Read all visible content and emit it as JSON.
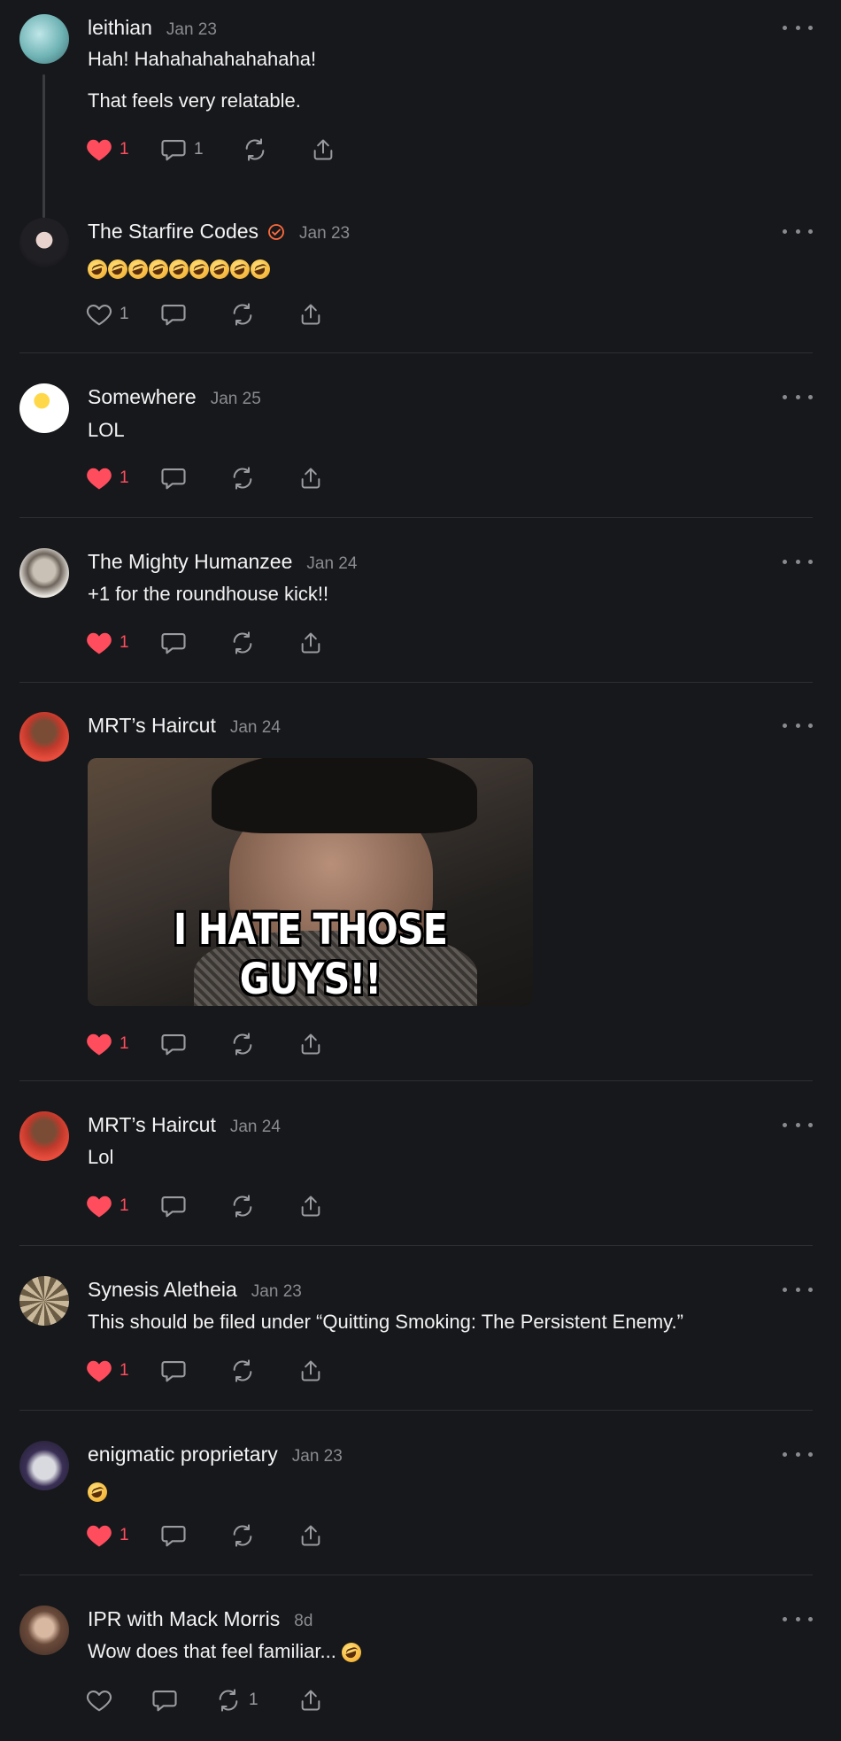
{
  "posts": [
    {
      "author": "leithian",
      "date": "Jan 23",
      "lines": [
        "Hah! Hahahahahahahaha!",
        "That feels very relatable."
      ],
      "likes": "1",
      "liked": true,
      "replies": "1",
      "reposts": "",
      "avatar_icon": "avatar-leithian"
    },
    {
      "author": "The Starfire Codes",
      "verified": true,
      "date": "Jan 23",
      "emoji_text": "🤣🤣🤣🤣🤣🤣🤣🤣🤣",
      "likes": "1",
      "liked": false,
      "replies": "",
      "reposts": "",
      "avatar_icon": "avatar-starfire"
    },
    {
      "author": "Somewhere",
      "date": "Jan 25",
      "lines": [
        "LOL"
      ],
      "likes": "1",
      "liked": true,
      "replies": "",
      "reposts": "",
      "avatar_icon": "avatar-daffodil"
    },
    {
      "author": "The Mighty Humanzee",
      "date": "Jan 24",
      "lines": [
        "+1 for the roundhouse kick!!"
      ],
      "likes": "1",
      "liked": true,
      "replies": "",
      "reposts": "",
      "avatar_icon": "avatar-humanzee"
    },
    {
      "author": "MRT’s Haircut",
      "date": "Jan 24",
      "gif_caption": "I HATE THOSE GUYS!!",
      "likes": "1",
      "liked": true,
      "replies": "",
      "reposts": "",
      "avatar_icon": "avatar-mrt"
    },
    {
      "author": "MRT’s Haircut",
      "date": "Jan 24",
      "lines": [
        "Lol"
      ],
      "likes": "1",
      "liked": true,
      "replies": "",
      "reposts": "",
      "avatar_icon": "avatar-mrt"
    },
    {
      "author": "Synesis Aletheia",
      "date": "Jan 23",
      "lines": [
        "This should be filed under “Quitting Smoking: The Persistent Enemy.”"
      ],
      "likes": "1",
      "liked": true,
      "replies": "",
      "reposts": "",
      "avatar_icon": "avatar-compass"
    },
    {
      "author": "enigmatic proprietary",
      "date": "Jan 23",
      "emoji_text": "🤣",
      "likes": "1",
      "liked": true,
      "replies": "",
      "reposts": "",
      "avatar_icon": "avatar-cat"
    },
    {
      "author": "IPR with Mack Morris",
      "date": "8d",
      "lines": [
        "Wow does that feel familiar... "
      ],
      "trailing_emoji": "🤣",
      "likes": "",
      "liked": false,
      "replies": "",
      "reposts": "1",
      "avatar_icon": "avatar-mack"
    }
  ],
  "colors": {
    "background": "#17181b",
    "like": "#ff4d5e",
    "verified": "#ff6a3d",
    "muted": "#8a8b90"
  }
}
